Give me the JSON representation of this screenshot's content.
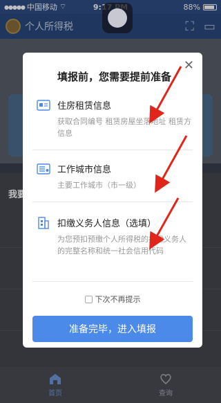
{
  "status_bar": {
    "carrier": "中国移动",
    "time": "9:17 PM",
    "battery": "88%"
  },
  "app_bar": {
    "title": "个人所得税"
  },
  "background": {
    "section_label": "我要"
  },
  "modal": {
    "title": "填报前，您需要提前准备",
    "items": [
      {
        "name": "住房租赁信息",
        "desc": "获取合同编号 租赁房屋坐落地址 租赁方信息"
      },
      {
        "name": "工作城市信息",
        "desc": "主要工作城市（市一级）"
      },
      {
        "name": "扣缴义务人信息（选填）",
        "desc": "为您预扣预缴个人所得税的扣缴义务人的完整名称和统一社会信用代码"
      }
    ],
    "dont_show_label": "下次不再提示",
    "confirm_label": "准备完毕，进入填报"
  },
  "tab_bar": {
    "tabs": [
      {
        "label": "首页"
      },
      {
        "label": "查询"
      }
    ]
  },
  "colors": {
    "accent": "#4b8ae8",
    "annotation_arrow": "#e1251b"
  }
}
